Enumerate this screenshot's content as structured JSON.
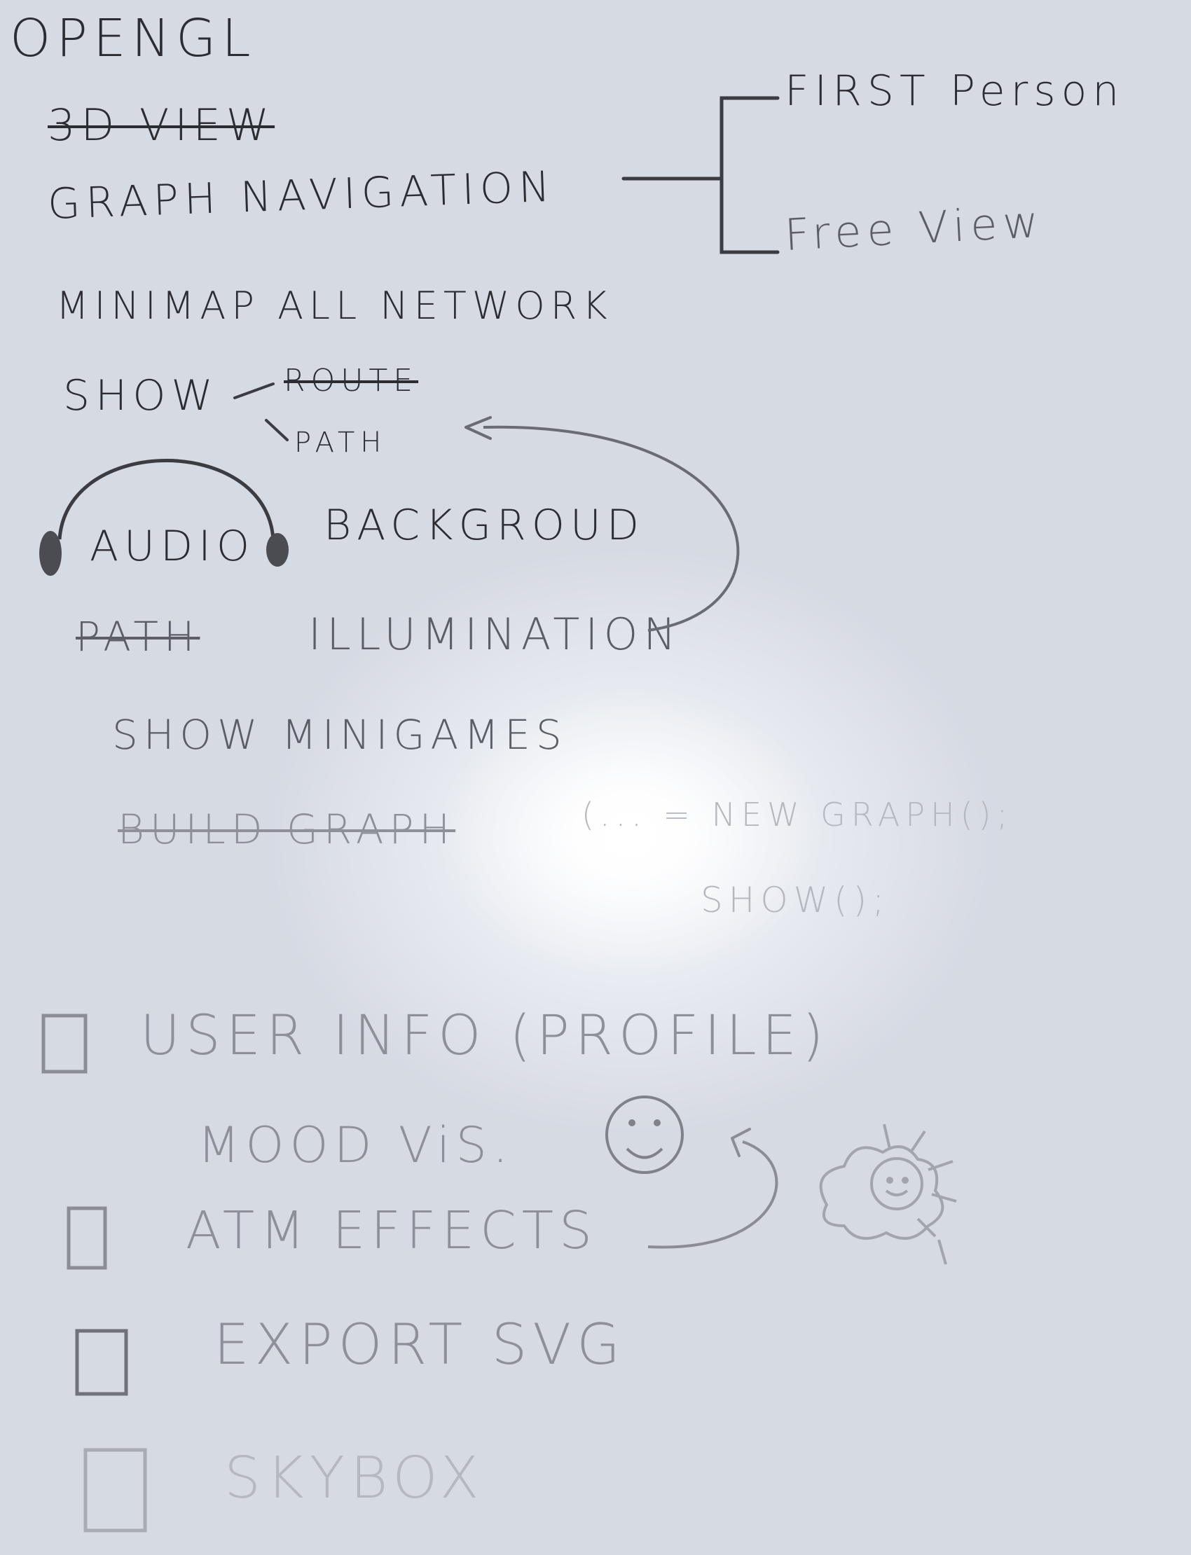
{
  "notes": {
    "opengl": "OPENGL",
    "view_3d": "3D VIEW",
    "graph_navigation": "GRAPH NAVIGATION",
    "first_person": "FIRST Person",
    "free_view": "Free View",
    "minimap": "MINIMAP ALL NETWORK",
    "show": "SHOW",
    "route": "ROUTE",
    "path": "PATH",
    "audio": "AUDIO",
    "background": "BACKGROUD",
    "path_illumination_path": "PATH",
    "path_illumination": "ILLUMINATION",
    "show_minigames": "SHOW MINIGAMES",
    "build_graph": "BUILD GRAPH",
    "code_line_1": "(... = NEW GRAPH();",
    "code_line_2": "SHOW();",
    "user_info": "USER INFO (PROFILE)",
    "mood_vis": "MOOD ViS.",
    "atm_effects": "ATM EFFECTS",
    "export_svg": "EXPORT SVG",
    "skybox": "SKYBOX"
  }
}
